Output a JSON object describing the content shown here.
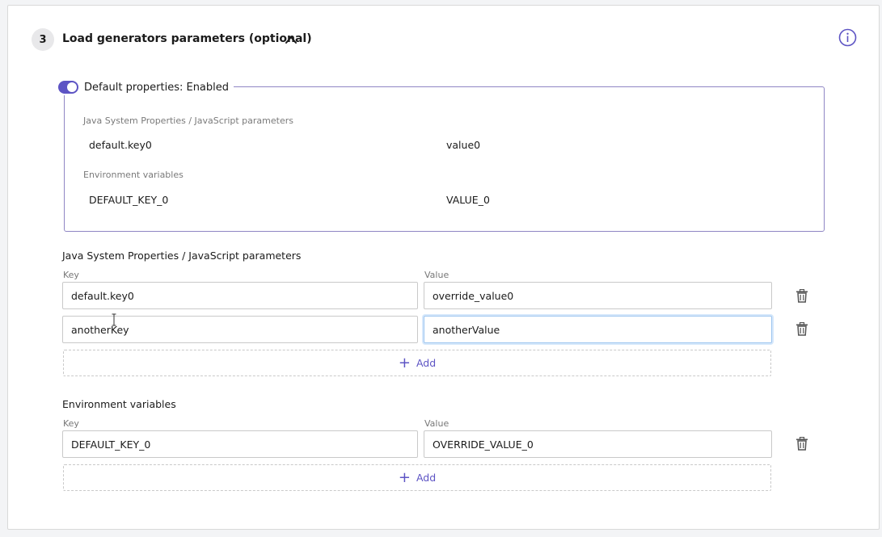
{
  "section": {
    "step_number": "3",
    "title": "Load generators parameters (optional)"
  },
  "defaults": {
    "toggle_label": "Default properties: Enabled",
    "toggle_on": true,
    "java_title": "Java System Properties / JavaScript parameters",
    "java_rows": [
      {
        "key": "default.key0",
        "value": "value0"
      }
    ],
    "env_title": "Environment variables",
    "env_rows": [
      {
        "key": "DEFAULT_KEY_0",
        "value": "VALUE_0"
      }
    ]
  },
  "java_params": {
    "title": "Java System Properties / JavaScript parameters",
    "key_label": "Key",
    "value_label": "Value",
    "rows": [
      {
        "key": "default.key0",
        "value": "override_value0"
      },
      {
        "key": "anotherKey",
        "value": "anotherValue"
      }
    ],
    "add_label": "Add"
  },
  "env_vars": {
    "title": "Environment variables",
    "key_label": "Key",
    "value_label": "Value",
    "rows": [
      {
        "key": "DEFAULT_KEY_0",
        "value": "OVERRIDE_VALUE_0"
      }
    ],
    "add_label": "Add"
  },
  "colors": {
    "accent": "#5d54c4",
    "border": "#c9c9c9",
    "focus": "#9ec6ef"
  },
  "icons": [
    "chevron-up-icon",
    "info-icon",
    "trash-icon",
    "plus-icon"
  ]
}
